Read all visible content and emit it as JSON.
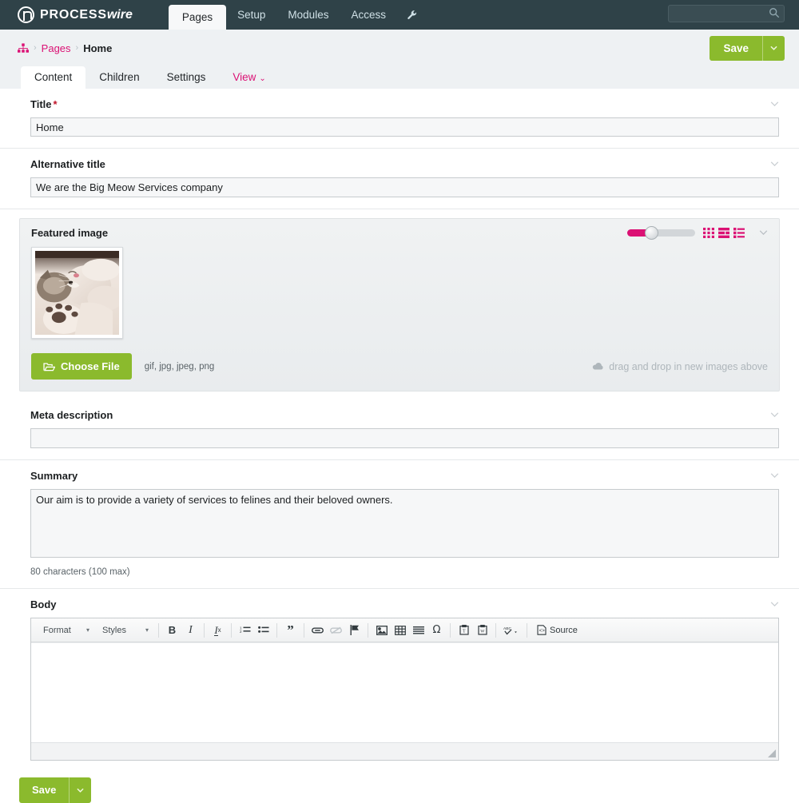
{
  "masthead": {
    "logo_text_main": "PROCESS",
    "logo_text_accent": "wire",
    "logo_icon": "processwire-p-logo",
    "nav": [
      {
        "label": "Pages",
        "active": true
      },
      {
        "label": "Setup",
        "active": false
      },
      {
        "label": "Modules",
        "active": false
      },
      {
        "label": "Access",
        "active": false
      }
    ],
    "tools_icon": "wrench-icon",
    "search": {
      "value": "",
      "placeholder": "",
      "icon": "search-icon"
    }
  },
  "breadcrumb": {
    "home_icon": "sitemap-icon",
    "items": [
      {
        "label": "Pages",
        "link": true
      },
      {
        "label": "Home",
        "link": false
      }
    ],
    "separator": "›"
  },
  "toolbar": {
    "save_label": "Save",
    "save_caret": "⌄"
  },
  "tabs": [
    {
      "label": "Content",
      "active": true,
      "pink": false,
      "caret": ""
    },
    {
      "label": "Children",
      "active": false,
      "pink": false,
      "caret": ""
    },
    {
      "label": "Settings",
      "active": false,
      "pink": false,
      "caret": ""
    },
    {
      "label": "View",
      "active": false,
      "pink": true,
      "caret": "⌄"
    }
  ],
  "fields": {
    "title": {
      "label": "Title",
      "required_marker": "*",
      "value": "Home",
      "placeholder": ""
    },
    "alt_title": {
      "label": "Alternative title",
      "value": "We are the Big Meow Services company",
      "placeholder": ""
    },
    "featured_image": {
      "label": "Featured image",
      "choose_label": "Choose File",
      "choose_icon": "folder-open-icon",
      "accepted_types": "gif, jpg, jpeg, png",
      "dragdrop_text": "drag and drop in new images above",
      "dragdrop_icon": "cloud-upload-icon",
      "view_icons": [
        "grid-view-icon",
        "list-view-icon",
        "compact-list-view-icon"
      ],
      "thumb_alt": "kitten-photo",
      "slider_value": 30
    },
    "meta_description": {
      "label": "Meta description",
      "value": "",
      "placeholder": ""
    },
    "summary": {
      "label": "Summary",
      "value": "Our aim is to provide a variety of services to felines and their beloved owners.",
      "placeholder": "",
      "note": "80 characters (100 max)"
    },
    "body": {
      "label": "Body",
      "value": "",
      "editor": {
        "format_label": "Format",
        "styles_label": "Styles",
        "source_label": "Source",
        "buttons": [
          {
            "name": "bold-icon",
            "glyph": "B"
          },
          {
            "name": "italic-icon",
            "glyph": "I"
          },
          {
            "name": "remove-format-icon",
            "glyph": "Iₓ"
          },
          {
            "name": "numbered-list-icon",
            "glyph": ""
          },
          {
            "name": "bulleted-list-icon",
            "glyph": ""
          },
          {
            "name": "blockquote-icon",
            "glyph": "”"
          },
          {
            "name": "link-icon",
            "glyph": ""
          },
          {
            "name": "unlink-icon",
            "glyph": ""
          },
          {
            "name": "anchor-flag-icon",
            "glyph": ""
          },
          {
            "name": "image-icon",
            "glyph": ""
          },
          {
            "name": "table-icon",
            "glyph": ""
          },
          {
            "name": "horizontal-rule-icon",
            "glyph": ""
          },
          {
            "name": "special-character-icon",
            "glyph": "Ω"
          },
          {
            "name": "paste-text-icon",
            "glyph": ""
          },
          {
            "name": "paste-word-icon",
            "glyph": ""
          },
          {
            "name": "spellcheck-icon",
            "glyph": ""
          },
          {
            "name": "source-icon",
            "glyph": ""
          }
        ]
      }
    }
  },
  "footer": {
    "save_label": "Save",
    "save_caret": "⌄"
  },
  "colors": {
    "masthead_bg": "#2f4248",
    "accent_pink": "#db1174",
    "accent_green": "#8bba2d",
    "page_bg": "#eef1f3",
    "required_red": "#c0152a"
  }
}
